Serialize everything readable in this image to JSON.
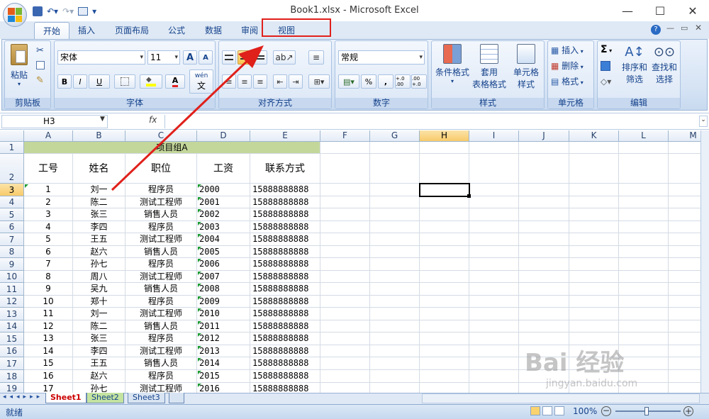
{
  "window": {
    "title": "Book1.xlsx - Microsoft Excel"
  },
  "tabs": [
    "开始",
    "插入",
    "页面布局",
    "公式",
    "数据",
    "审阅",
    "视图"
  ],
  "ribbon": {
    "clipboard": {
      "label": "剪贴板",
      "paste": "粘贴"
    },
    "font": {
      "label": "字体",
      "name": "宋体",
      "size": "11",
      "bold": "B",
      "italic": "I",
      "underline": "U",
      "grow": "A",
      "shrink": "A",
      "wen": "wén",
      "color_a": "A"
    },
    "alignment": {
      "label": "对齐方式"
    },
    "number": {
      "label": "数字",
      "format": "常规",
      "percent": "%",
      "comma": ",",
      "inc": "+.0 .00",
      "dec": ".00 +.0"
    },
    "styles": {
      "label": "样式",
      "cond": "条件格式",
      "table_1": "套用",
      "table_2": "表格格式",
      "cell_1": "单元格",
      "cell_2": "样式"
    },
    "cells": {
      "label": "单元格",
      "insert": "插入",
      "delete": "删除",
      "format": "格式"
    },
    "editing": {
      "label": "编辑",
      "sort_1": "排序和",
      "sort_2": "筛选",
      "find_1": "查找和",
      "find_2": "选择",
      "sigma": "Σ"
    }
  },
  "formula_bar": {
    "name_box": "H3",
    "fx": "fx",
    "value": ""
  },
  "sheet": {
    "columns": [
      "A",
      "B",
      "C",
      "D",
      "E",
      "F",
      "G",
      "H",
      "I",
      "J",
      "K",
      "L",
      "M"
    ],
    "selected_cell": "H3",
    "merged_title": "项目组A",
    "headers": [
      "工号",
      "姓名",
      "职位",
      "工资",
      "联系方式"
    ],
    "rows": [
      [
        "1",
        "刘一",
        "程序员",
        "2000",
        "15888888888"
      ],
      [
        "2",
        "陈二",
        "测试工程师",
        "2001",
        "15888888888"
      ],
      [
        "3",
        "张三",
        "销售人员",
        "2002",
        "15888888888"
      ],
      [
        "4",
        "李四",
        "程序员",
        "2003",
        "15888888888"
      ],
      [
        "5",
        "王五",
        "测试工程师",
        "2004",
        "15888888888"
      ],
      [
        "6",
        "赵六",
        "销售人员",
        "2005",
        "15888888888"
      ],
      [
        "7",
        "孙七",
        "程序员",
        "2006",
        "15888888888"
      ],
      [
        "8",
        "周八",
        "测试工程师",
        "2007",
        "15888888888"
      ],
      [
        "9",
        "吴九",
        "销售人员",
        "2008",
        "15888888888"
      ],
      [
        "10",
        "郑十",
        "程序员",
        "2009",
        "15888888888"
      ],
      [
        "11",
        "刘一",
        "测试工程师",
        "2010",
        "15888888888"
      ],
      [
        "12",
        "陈二",
        "销售人员",
        "2011",
        "15888888888"
      ],
      [
        "13",
        "张三",
        "程序员",
        "2012",
        "15888888888"
      ],
      [
        "14",
        "李四",
        "测试工程师",
        "2013",
        "15888888888"
      ],
      [
        "15",
        "王五",
        "销售人员",
        "2014",
        "15888888888"
      ],
      [
        "16",
        "赵六",
        "程序员",
        "2015",
        "15888888888"
      ],
      [
        "17",
        "孙七",
        "测试工程师",
        "2016",
        "15888888888"
      ]
    ],
    "row_numbers": [
      "1",
      "2",
      "3",
      "4",
      "5",
      "6",
      "7",
      "8",
      "9",
      "10",
      "11",
      "12",
      "13",
      "14",
      "15",
      "16",
      "17",
      "18",
      "19"
    ]
  },
  "sheet_tabs": [
    "Sheet1",
    "Sheet2",
    "Sheet3"
  ],
  "status": {
    "ready": "就绪",
    "zoom": "100%"
  },
  "watermark": {
    "text": "Bai 经验",
    "url": "jingyan.baidu.com"
  },
  "colors": {
    "title_fill": "#c4d79b",
    "highlight": "#e0201b",
    "selected_header": "#f8cb6a"
  }
}
